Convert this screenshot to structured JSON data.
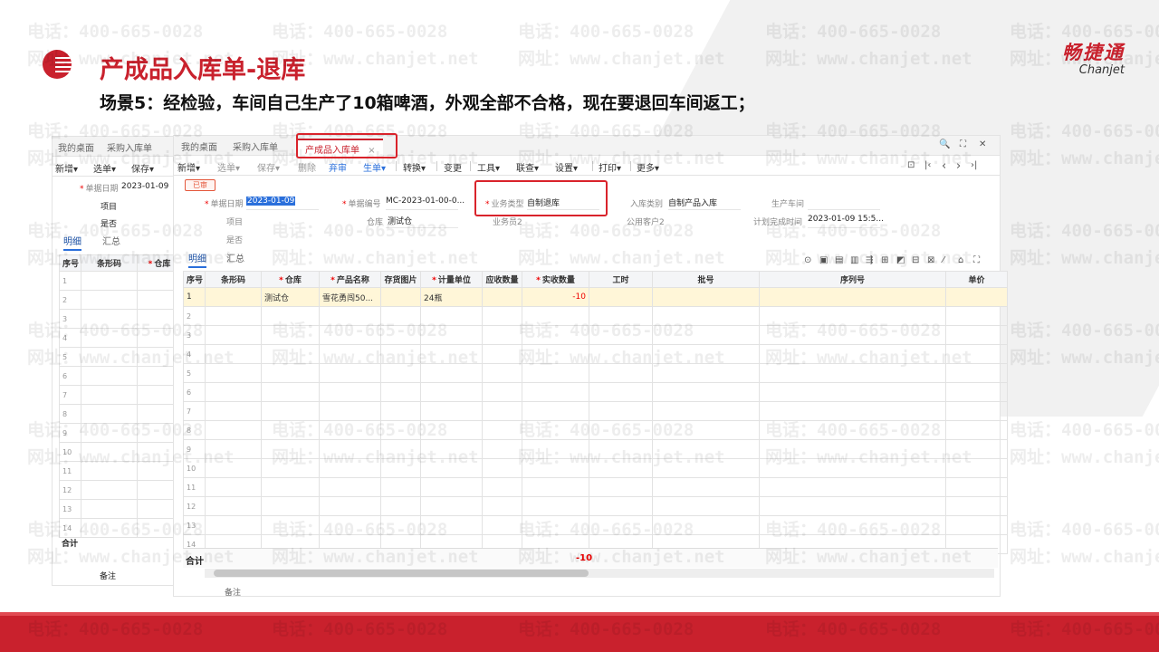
{
  "slide": {
    "title": "产成品入库单-退库",
    "subtitle": "场景5：经检验，车间自己生产了10箱啤酒，外观全部不合格，现在要退回车间返工；",
    "brand_cn": "畅捷通",
    "brand_en": "Chanjet",
    "watermark_phone": "电话：400-665-0028",
    "watermark_site": "网址：www.chanjet.net",
    "colors": {
      "accent": "#c9212d",
      "highlight_box": "#d9232b",
      "selected_row": "#fff6d8",
      "link_blue": "#2a6fdb"
    }
  },
  "back_window": {
    "tabs": [
      "我的桌面",
      "采购入库单"
    ],
    "toolbar": [
      "新增",
      "选单",
      "保存"
    ],
    "doc_date_label": "单据日期",
    "doc_date": "2023-01-09",
    "project_label": "项目",
    "yesno_label": "是否",
    "subtabs": [
      "明细",
      "汇总"
    ],
    "columns": [
      "序号",
      "条形码",
      "仓库"
    ],
    "row_numbers": [
      "1",
      "2",
      "3",
      "4",
      "5",
      "6",
      "7",
      "8",
      "9",
      "10",
      "11",
      "12",
      "13",
      "14"
    ],
    "total_label": "合计",
    "remark_label": "备注"
  },
  "main_window": {
    "tabs": {
      "home": "我的桌面",
      "purchase": "采购入库单",
      "active": "产成品入库单",
      "close": "×"
    },
    "window_controls": {
      "search": "🔍",
      "maximize": "⛶",
      "close": "✕"
    },
    "toolbar": {
      "new": "新增",
      "pick": "选单",
      "save": "保存",
      "delete": "删除",
      "audit": "弃审",
      "generate": "生单",
      "convert": "转换",
      "change": "变更",
      "tools": "工具",
      "query": "联查",
      "settings": "设置",
      "print": "打印",
      "more": "更多"
    },
    "nav": {
      "preview": "⊡",
      "first": "|‹",
      "prev": "‹",
      "next": "›",
      "last": "›|"
    },
    "status": "已审",
    "header": {
      "doc_date_label": "单据日期",
      "doc_date": "2023-01-09",
      "doc_no_label": "单据编号",
      "doc_no": "MC-2023-01-00-0...",
      "biz_type_label": "业务类型",
      "biz_type": "自制退库",
      "in_category_label": "入库类别",
      "in_category": "自制产品入库",
      "workshop_label": "生产车间",
      "workshop": "",
      "project_label": "项目",
      "project": "",
      "warehouse_label": "仓库",
      "warehouse": "测试仓",
      "staff_label": "业务员2",
      "staff": "",
      "customer_label": "公用客户2",
      "customer": "",
      "plan_time_label": "计划完成时间",
      "plan_time": "2023-01-09 15:5...",
      "yesno_label": "是否",
      "yesno": ""
    },
    "subtabs": {
      "detail": "明细",
      "summary": "汇总"
    },
    "grid_icons": [
      "⊙",
      "▣",
      "▤",
      "▥",
      "⇶",
      "⊞",
      "◩",
      "⊟",
      "⊠",
      "⁄",
      "⌂",
      "⛶"
    ],
    "columns": [
      "序号",
      "条形码",
      "仓库",
      "产品名称",
      "存货图片",
      "计量单位",
      "应收数量",
      "实收数量",
      "工时",
      "批号",
      "序列号",
      "单价"
    ],
    "required_columns": [
      "仓库",
      "产品名称",
      "计量单位",
      "实收数量"
    ],
    "rows": [
      {
        "no": "1",
        "barcode": "",
        "warehouse": "测试仓",
        "product": "雪花勇闯50...",
        "image": "",
        "unit": "24瓶",
        "due_qty": "",
        "actual_qty": "-10",
        "hours": "",
        "batch": "",
        "serial": "",
        "price": ""
      }
    ],
    "empty_row_numbers": [
      "2",
      "3",
      "4",
      "5",
      "6",
      "7",
      "8",
      "9",
      "10",
      "11",
      "12",
      "13",
      "14"
    ],
    "total_label": "合计",
    "total_qty": "-10",
    "remark_label": "备注"
  }
}
